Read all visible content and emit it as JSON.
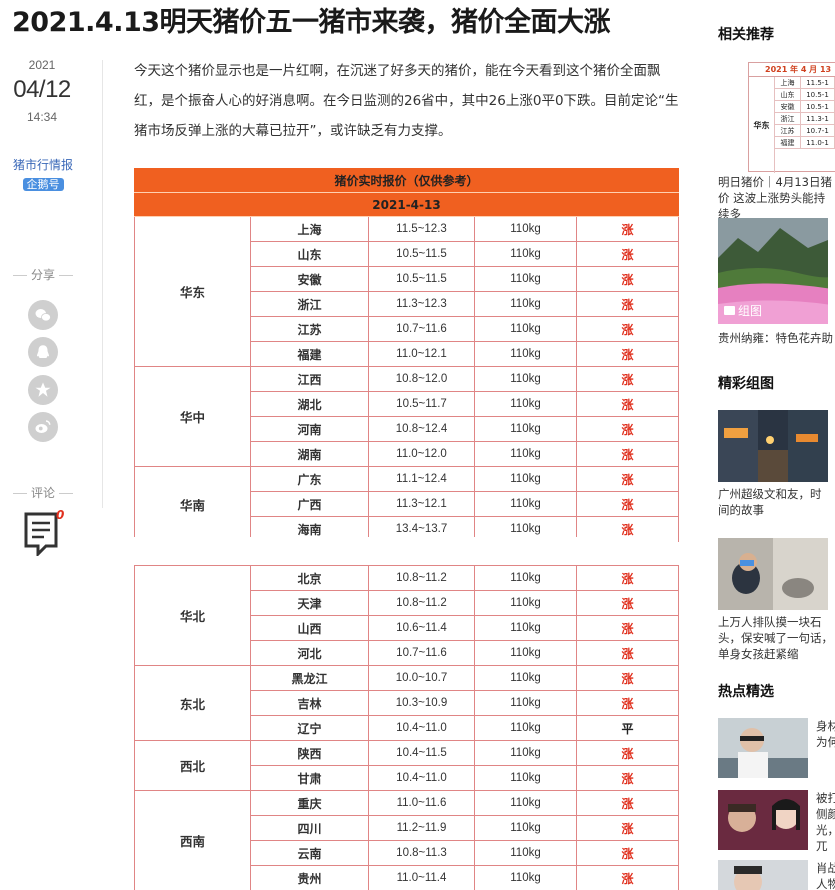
{
  "article": {
    "title": "2021.4.13明天猪价五一猪市来袭，猪价全面大涨",
    "year": "2021",
    "month_day": "04/12",
    "time": "14:34",
    "source_name": "猪市行情报",
    "source_badge": "企鹅号",
    "share_label": "分享",
    "comment_label": "评论",
    "comment_count": "0",
    "paragraph": "今天这个猪价显示也是一片红啊，在沉迷了好多天的猪价，能在今天看到这个猪价全面飘红，是个振奋人心的好消息啊。在今日监测的26省中，其中26上涨0平0下跌。目前定论“生猪市场反弹上涨的大幕已拉开”，或许缺乏有力支撑。"
  },
  "table": {
    "title": "猪价实时报价（仅供参考）",
    "date": "2021-4-13",
    "part1": [
      {
        "region": "华东",
        "rows": [
          {
            "prov": "上海",
            "price": "11.5~12.3",
            "weight": "110kg",
            "trend": "涨"
          },
          {
            "prov": "山东",
            "price": "10.5~11.5",
            "weight": "110kg",
            "trend": "涨"
          },
          {
            "prov": "安徽",
            "price": "10.5~11.5",
            "weight": "110kg",
            "trend": "涨"
          },
          {
            "prov": "浙江",
            "price": "11.3~12.3",
            "weight": "110kg",
            "trend": "涨"
          },
          {
            "prov": "江苏",
            "price": "10.7~11.6",
            "weight": "110kg",
            "trend": "涨"
          },
          {
            "prov": "福建",
            "price": "11.0~12.1",
            "weight": "110kg",
            "trend": "涨"
          }
        ]
      },
      {
        "region": "华中",
        "rows": [
          {
            "prov": "江西",
            "price": "10.8~12.0",
            "weight": "110kg",
            "trend": "涨"
          },
          {
            "prov": "湖北",
            "price": "10.5~11.7",
            "weight": "110kg",
            "trend": "涨"
          },
          {
            "prov": "河南",
            "price": "10.8~12.4",
            "weight": "110kg",
            "trend": "涨"
          },
          {
            "prov": "湖南",
            "price": "11.0~12.0",
            "weight": "110kg",
            "trend": "涨"
          }
        ]
      },
      {
        "region": "华南",
        "rows": [
          {
            "prov": "广东",
            "price": "11.1~12.4",
            "weight": "110kg",
            "trend": "涨"
          },
          {
            "prov": "广西",
            "price": "11.3~12.1",
            "weight": "110kg",
            "trend": "涨"
          },
          {
            "prov": "海南",
            "price": "13.4~13.7",
            "weight": "110kg",
            "trend": "涨"
          }
        ]
      }
    ],
    "part2": [
      {
        "region": "华北",
        "rows": [
          {
            "prov": "北京",
            "price": "10.8~11.2",
            "weight": "110kg",
            "trend": "涨"
          },
          {
            "prov": "天津",
            "price": "10.8~11.2",
            "weight": "110kg",
            "trend": "涨"
          },
          {
            "prov": "山西",
            "price": "10.6~11.4",
            "weight": "110kg",
            "trend": "涨"
          },
          {
            "prov": "河北",
            "price": "10.7~11.6",
            "weight": "110kg",
            "trend": "涨"
          }
        ]
      },
      {
        "region": "东北",
        "rows": [
          {
            "prov": "黑龙江",
            "price": "10.0~10.7",
            "weight": "110kg",
            "trend": "涨"
          },
          {
            "prov": "吉林",
            "price": "10.3~10.9",
            "weight": "110kg",
            "trend": "涨"
          },
          {
            "prov": "辽宁",
            "price": "10.4~11.0",
            "weight": "110kg",
            "trend": "平"
          }
        ]
      },
      {
        "region": "西北",
        "rows": [
          {
            "prov": "陕西",
            "price": "10.4~11.5",
            "weight": "110kg",
            "trend": "涨"
          },
          {
            "prov": "甘肃",
            "price": "10.4~11.0",
            "weight": "110kg",
            "trend": "涨"
          }
        ]
      },
      {
        "region": "西南",
        "rows": [
          {
            "prov": "重庆",
            "price": "11.0~11.6",
            "weight": "110kg",
            "trend": "涨"
          },
          {
            "prov": "四川",
            "price": "11.2~11.9",
            "weight": "110kg",
            "trend": "涨"
          },
          {
            "prov": "云南",
            "price": "10.8~11.3",
            "weight": "110kg",
            "trend": "涨"
          },
          {
            "prov": "贵州",
            "price": "11.0~11.4",
            "weight": "110kg",
            "trend": "涨"
          }
        ]
      }
    ]
  },
  "sidebar": {
    "related_title": "相关推荐",
    "related_items": [
      {
        "thumb_title": "2021 年 4 月 13",
        "caption": "明日猪价｜4月13日猪价 这波上涨势头能持续多"
      },
      {
        "gallery_tag": "组图",
        "caption": "贵州纳雍：特色花卉助"
      }
    ],
    "mini_table": {
      "region": "华东",
      "rows": [
        {
          "prov": "上海",
          "price": "11.5-1"
        },
        {
          "prov": "山东",
          "price": "10.5-1"
        },
        {
          "prov": "安徽",
          "price": "10.5-1"
        },
        {
          "prov": "浙江",
          "price": "11.3-1"
        },
        {
          "prov": "江苏",
          "price": "10.7-1"
        },
        {
          "prov": "福建",
          "price": "11.0-1"
        }
      ]
    },
    "gallery_title": "精彩组图",
    "gallery_items": [
      {
        "caption": "广州超级文和友，时 间的故事"
      },
      {
        "caption": "上万人排队摸一块石头，保安喊了一句话，单身女孩赶紧缩"
      }
    ],
    "hot_title": "热点精选",
    "hot_items": [
      {
        "caption": "身材 为何"
      },
      {
        "caption": "被打 侧颜 光， 兀"
      },
      {
        "caption": "肖战 人物"
      }
    ]
  },
  "colors": {
    "header_orange": "#f06020",
    "up_red": "#e0301e",
    "border_red": "#e08585"
  }
}
